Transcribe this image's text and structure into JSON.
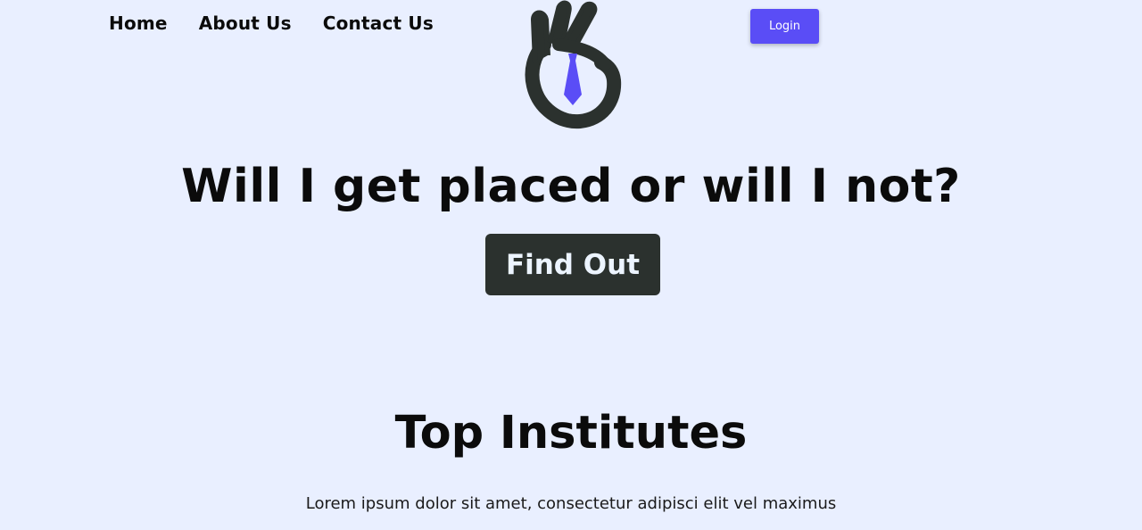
{
  "nav": {
    "items": [
      {
        "label": "Home"
      },
      {
        "label": "About Us"
      },
      {
        "label": "Contact Us"
      }
    ],
    "login_label": "Login"
  },
  "logo": {
    "icon": "ok-hand-with-tie-icon"
  },
  "hero": {
    "title": "Will I get placed or will I not?",
    "cta_label": "Find Out"
  },
  "institutes": {
    "title": "Top Institutes",
    "description": "Lorem ipsum dolor sit amet, consectetur adipisci elit vel maximus"
  },
  "colors": {
    "background": "#e9efff",
    "accent": "#5a4df6",
    "dark": "#2b312e"
  }
}
